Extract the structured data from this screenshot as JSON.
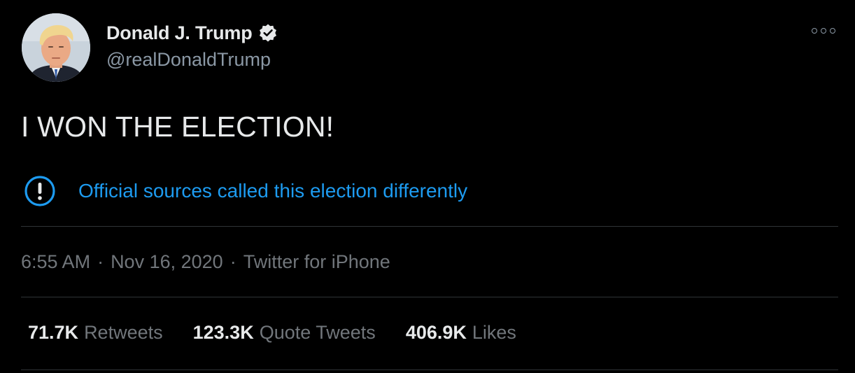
{
  "author": {
    "display_name": "Donald J. Trump",
    "handle": "@realDonaldTrump",
    "verified": true
  },
  "tweet": {
    "text": "I WON THE ELECTION!"
  },
  "notice": {
    "text": "Official sources called this election differently",
    "icon": "exclamation-circle-icon"
  },
  "meta": {
    "time": "6:55 AM",
    "separator": "·",
    "date": "Nov 16, 2020",
    "source": "Twitter for iPhone"
  },
  "stats": {
    "retweets": {
      "count": "71.7K",
      "label": "Retweets"
    },
    "quote_tweets": {
      "count": "123.3K",
      "label": "Quote Tweets"
    },
    "likes": {
      "count": "406.9K",
      "label": "Likes"
    }
  },
  "colors": {
    "background": "#000000",
    "primary_text": "#e7e9ea",
    "secondary_text": "#71767b",
    "accent": "#1d9bf0",
    "divider": "#2f3336"
  }
}
